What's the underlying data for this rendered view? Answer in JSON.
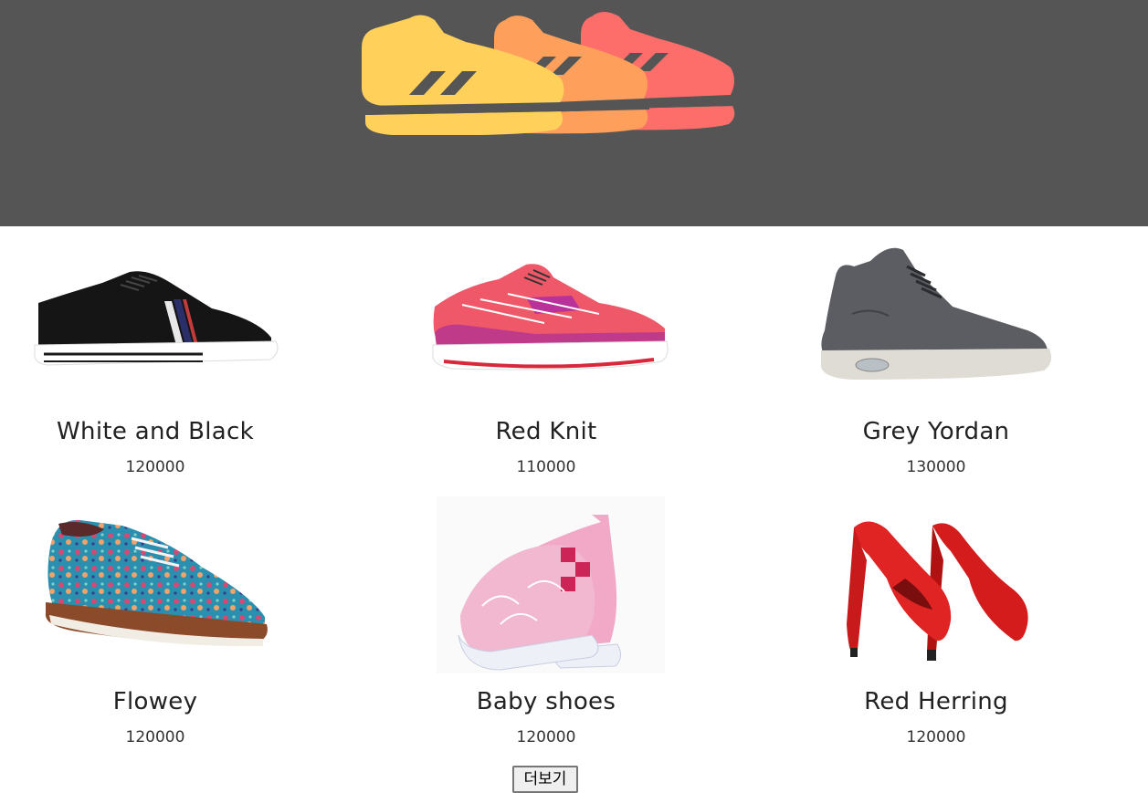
{
  "header": {
    "logo_icon": "sneakers-logo-icon",
    "colors": {
      "background": "#555555",
      "shoe_yellow": "#ffd05a",
      "shoe_orange": "#fe9f5b",
      "shoe_red": "#fd6e6a"
    }
  },
  "products": [
    {
      "name": "White and Black",
      "price": "120000",
      "image": "black-sneaker-image"
    },
    {
      "name": "Red Knit",
      "price": "110000",
      "image": "red-knit-running-shoe-image"
    },
    {
      "name": "Grey Yordan",
      "price": "130000",
      "image": "grey-high-top-sneaker-image"
    },
    {
      "name": "Flowey",
      "price": "120000",
      "image": "floral-oxford-shoe-image"
    },
    {
      "name": "Baby shoes",
      "price": "120000",
      "image": "pink-slip-on-shoes-image"
    },
    {
      "name": "Red Herring",
      "price": "120000",
      "image": "red-high-heels-image"
    }
  ],
  "more_button": {
    "label": "더보기"
  }
}
